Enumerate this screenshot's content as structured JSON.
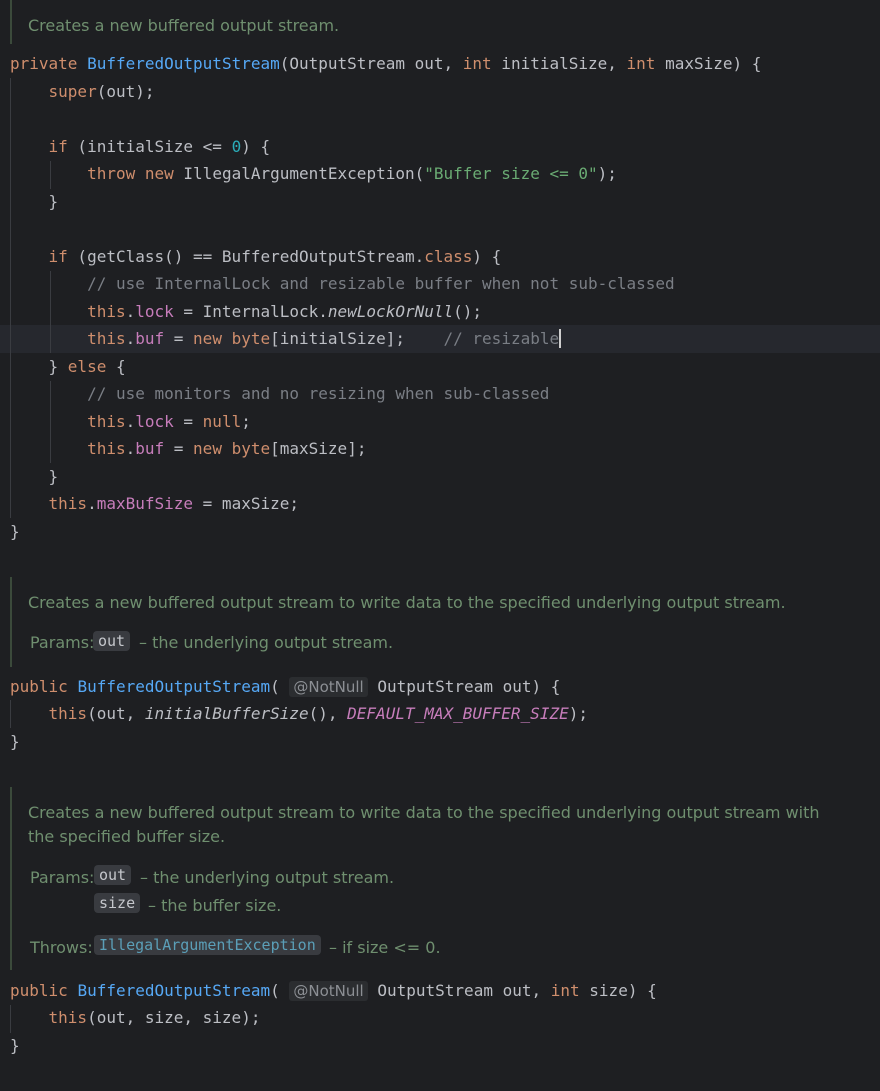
{
  "doc1": {
    "summary": "Creates a new buffered output stream."
  },
  "code1": {
    "kw_private": "private",
    "ctor_name": "BufferedOutputStream",
    "sig_rest_1": "(OutputStream out, ",
    "kw_int": "int",
    "sig_rest_2": " initialSize, ",
    "sig_rest_3": " maxSize) {",
    "kw_super": "super",
    "super_args": "(out);",
    "kw_if": "if",
    "if1_cond_a": " (initialSize <= ",
    "if1_num": "0",
    "if1_cond_b": ") {",
    "kw_throw": "throw",
    "kw_new": "new",
    "throw_type": " IllegalArgumentException(",
    "throw_msg": "\"Buffer size <= 0\"",
    "throw_end": ");",
    "close_brace": "}",
    "if2_cond_a": " (getClass() == BufferedOutputStream.",
    "kw_class": "class",
    "if2_cond_b": ") {",
    "comment_internal_lock": "// use InternalLock and resizable buffer when not sub-classed",
    "kw_this": "this",
    "dot": ".",
    "fld_lock": "lock",
    "lock_assign_a": " = InternalLock.",
    "lock_method": "newLockOrNull",
    "lock_assign_b": "();",
    "fld_buf": "buf",
    "assign_eq": " = ",
    "kw_byte": "byte",
    "buf_init_size": "[initialSize];",
    "comment_resizable": "// resizable",
    "else_open_a": "} ",
    "kw_else": "else",
    "else_open_b": " {",
    "comment_monitors": "// use monitors and no resizing when sub-classed",
    "kw_null": "null",
    "semicolon": ";",
    "buf_max_size": "[maxSize];",
    "fld_maxbufsize": "maxBufSize",
    "maxbuf_assign": " = maxSize;"
  },
  "doc2": {
    "summary": "Creates a new buffered output stream to write data to the specified underlying output stream.",
    "params_label": "Params:",
    "param_out_name": "out",
    "param_out_desc": "– the underlying output stream."
  },
  "code2": {
    "kw_public": "public",
    "ctor_name": "BufferedOutputStream",
    "paren_open": "(",
    "annotation": "@NotNull",
    "sig_rest": "OutputStream out) {",
    "kw_this": "this",
    "call_a": "(out, ",
    "call_method": "initialBufferSize",
    "call_b": "(), ",
    "call_const": "DEFAULT_MAX_BUFFER_SIZE",
    "call_c": ");",
    "close_brace": "}"
  },
  "doc3": {
    "summary_line1": "Creates a new buffered output stream to write data to the specified underlying output stream with",
    "summary_line2": "the specified buffer size.",
    "params_label": "Params:",
    "param_out_name": "out",
    "param_out_desc": "– the underlying output stream.",
    "param_size_name": "size",
    "param_size_desc": "– the buffer size.",
    "throws_label": "Throws:",
    "throws_type": "IllegalArgumentException",
    "throws_desc": "– if size <= 0."
  },
  "code3": {
    "kw_public": "public",
    "ctor_name": "BufferedOutputStream",
    "paren_open": "(",
    "annotation": "@NotNull",
    "sig_rest_a": "OutputStream out, ",
    "kw_int": "int",
    "sig_rest_b": " size) {",
    "kw_this": "this",
    "call_args": "(out, size, size);",
    "close_brace": "}"
  }
}
